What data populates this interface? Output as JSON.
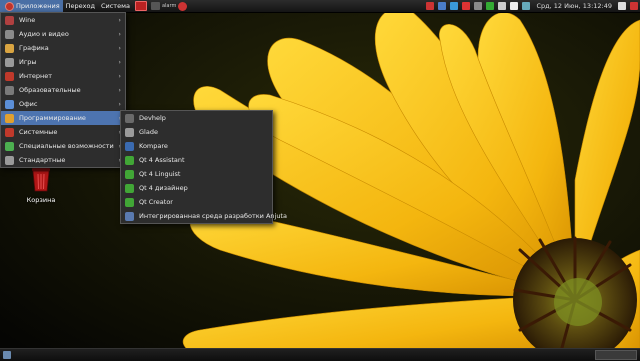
{
  "top_panel": {
    "menus": [
      "Приложения",
      "Переход",
      "Система"
    ],
    "launcher_text": "alarm",
    "clock": "Срд, 12 Июн, 13:12:49"
  },
  "app_menu": {
    "items": [
      {
        "label": "Wine",
        "icon": "wine-icon",
        "color": "#b04040"
      },
      {
        "label": "Аудио и видео",
        "icon": "audio-video-icon",
        "color": "#8a8a8a"
      },
      {
        "label": "Графика",
        "icon": "graphics-icon",
        "color": "#d9a441"
      },
      {
        "label": "Игры",
        "icon": "games-icon",
        "color": "#9a9a9a"
      },
      {
        "label": "Интернет",
        "icon": "internet-icon",
        "color": "#c0392b"
      },
      {
        "label": "Образовательные",
        "icon": "education-icon",
        "color": "#7a7a7a"
      },
      {
        "label": "Офис",
        "icon": "office-icon",
        "color": "#5b8ed6"
      },
      {
        "label": "Программирование",
        "icon": "programming-icon",
        "color": "#e0a030"
      },
      {
        "label": "Системные",
        "icon": "system-icon",
        "color": "#c0392b"
      },
      {
        "label": "Специальные возможности",
        "icon": "accessibility-icon",
        "color": "#4caf50"
      },
      {
        "label": "Стандартные",
        "icon": "accessories-icon",
        "color": "#9a9a9a"
      }
    ],
    "selected_index": 7
  },
  "submenu": {
    "items": [
      {
        "label": "Devhelp",
        "icon": "devhelp-icon",
        "color": "#6a6a6a"
      },
      {
        "label": "Glade",
        "icon": "glade-icon",
        "color": "#9a9a9a"
      },
      {
        "label": "Kompare",
        "icon": "kompare-icon",
        "color": "#3a6ab0"
      },
      {
        "label": "Qt 4 Assistant",
        "icon": "qt-assistant-icon",
        "color": "#41a636"
      },
      {
        "label": "Qt 4 Linguist",
        "icon": "qt-linguist-icon",
        "color": "#41a636"
      },
      {
        "label": "Qt 4 дизайнер",
        "icon": "qt-designer-icon",
        "color": "#41a636"
      },
      {
        "label": "Qt Creator",
        "icon": "qt-creator-icon",
        "color": "#41a636"
      },
      {
        "label": "Интегрированная среда разработки Anjuta",
        "icon": "anjuta-icon",
        "color": "#5a7ab0"
      }
    ]
  },
  "desktop": {
    "trash_label": "Корзина"
  },
  "colors": {
    "selection": "#4d74b0",
    "menu_bg": "#2d2d2d",
    "panel_bg": "#1e1e1e",
    "flower_yellow": "#f5c518"
  }
}
